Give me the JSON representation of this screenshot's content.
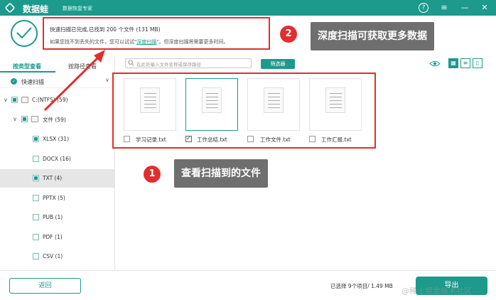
{
  "app": {
    "name": "数据蛙",
    "subtitle": "数据恢复专家"
  },
  "window_controls": {
    "help": "?",
    "menu": "≡",
    "minimize": "—",
    "close": "✕"
  },
  "status": {
    "main": "快速扫描已完成,已找到 200 个文件 (131 MB)",
    "hint_before": "如果您找不到丢失的文件，您可以试试\"",
    "hint_link": "深度扫描",
    "hint_after": "\"。但深度扫描将需要更多时间。"
  },
  "tabs": {
    "by_type": "按类型查看",
    "by_path": "按路径查看"
  },
  "scan_mode": "快速扫描",
  "tree": [
    {
      "label": "C:(NTFS) (59)",
      "expand": "∨",
      "checkbox": "partial"
    },
    {
      "label": "文件 (59)",
      "expand": "∨",
      "checkbox": "partial"
    },
    {
      "label": "XLSX (31)",
      "checkbox": "partial"
    },
    {
      "label": "DOCX (16)",
      "checkbox": "none"
    },
    {
      "label": "TXT (4)",
      "checkbox": "partial",
      "selected": true
    },
    {
      "label": "PPTX (5)",
      "checkbox": "none"
    },
    {
      "label": "PUB (1)",
      "checkbox": "none"
    },
    {
      "label": "PDF (1)",
      "checkbox": "none"
    },
    {
      "label": "CSV (1)",
      "checkbox": "none"
    }
  ],
  "search": {
    "placeholder": "在此处输入文件名称或保存路径"
  },
  "filter_button": "筛选器",
  "files": [
    {
      "name": "学习记录.txt",
      "checked": false
    },
    {
      "name": "工作总结.txt",
      "checked": true
    },
    {
      "name": "工作文件.txt",
      "checked": false
    },
    {
      "name": "工作汇报.txt",
      "checked": false
    }
  ],
  "callouts": {
    "deep_scan": {
      "number": "2",
      "text": "深度扫描可获取更多数据"
    },
    "view_files": {
      "number": "1",
      "text": "查看扫描到的文件"
    }
  },
  "bottom": {
    "back": "返回",
    "selected": "已选择 9个项目/ 1.49 MB",
    "export": "导出",
    "watermark": "@稀土掘金技术社区"
  },
  "colors": {
    "accent": "#1c9a8c",
    "highlight": "#e02f2f",
    "callout": "#6f6f6f"
  }
}
